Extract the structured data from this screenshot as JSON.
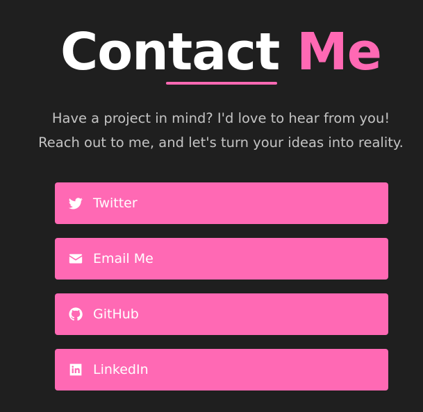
{
  "header": {
    "title_word1": "Contact",
    "title_word2": "Me",
    "accent_color": "#ff69b4"
  },
  "tagline": {
    "line1": "Have a project in mind? I'd love to hear from you!",
    "line2": "Reach out to me, and let's turn your ideas into reality."
  },
  "links": [
    {
      "label": "Twitter",
      "icon": "twitter-icon"
    },
    {
      "label": "Email Me",
      "icon": "envelope-icon"
    },
    {
      "label": "GitHub",
      "icon": "github-icon"
    },
    {
      "label": "LinkedIn",
      "icon": "linkedin-icon"
    }
  ],
  "colors": {
    "background": "#1f1f1f",
    "button": "#ff69b4",
    "text_muted": "#c4c4c4"
  }
}
